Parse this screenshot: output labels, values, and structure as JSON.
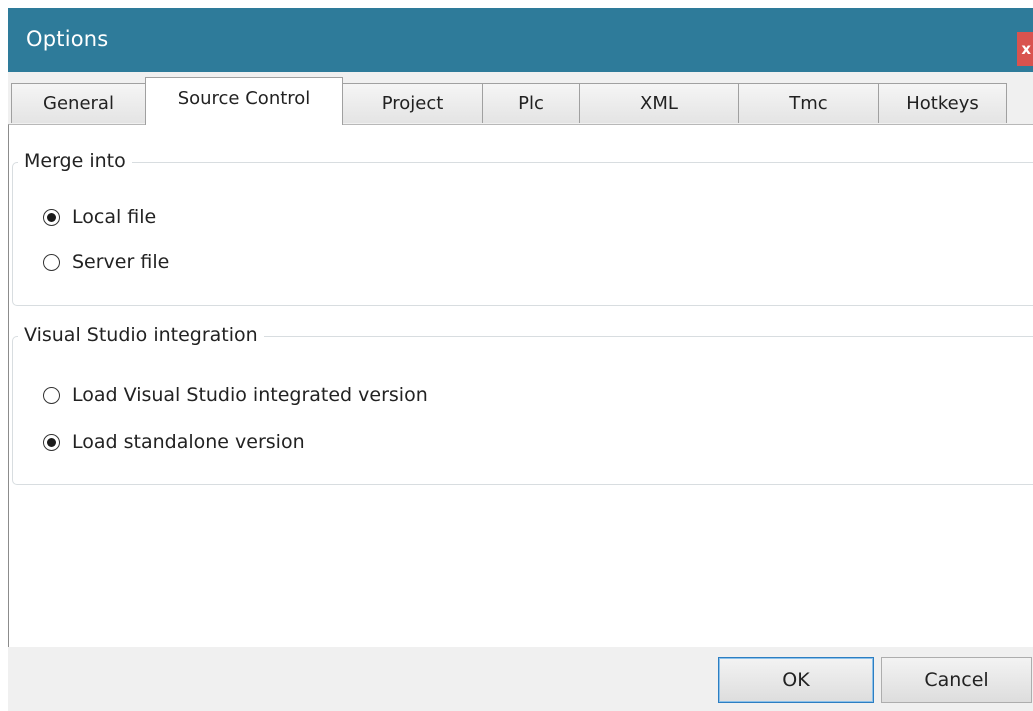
{
  "window": {
    "title": "Options",
    "close_label": "x"
  },
  "tabs": [
    {
      "label": "General"
    },
    {
      "label": "Source Control",
      "active": true
    },
    {
      "label": "Project"
    },
    {
      "label": "Plc"
    },
    {
      "label": "XML"
    },
    {
      "label": "Tmc"
    },
    {
      "label": "Hotkeys"
    }
  ],
  "merge_into": {
    "title": "Merge into",
    "options": [
      {
        "label": "Local file",
        "checked": true
      },
      {
        "label": "Server file",
        "checked": false
      }
    ]
  },
  "vs_integration": {
    "title": "Visual Studio integration",
    "options": [
      {
        "label": "Load Visual Studio integrated version",
        "checked": false
      },
      {
        "label": "Load standalone version",
        "checked": true
      }
    ]
  },
  "footer": {
    "ok_label": "OK",
    "cancel_label": "Cancel"
  }
}
